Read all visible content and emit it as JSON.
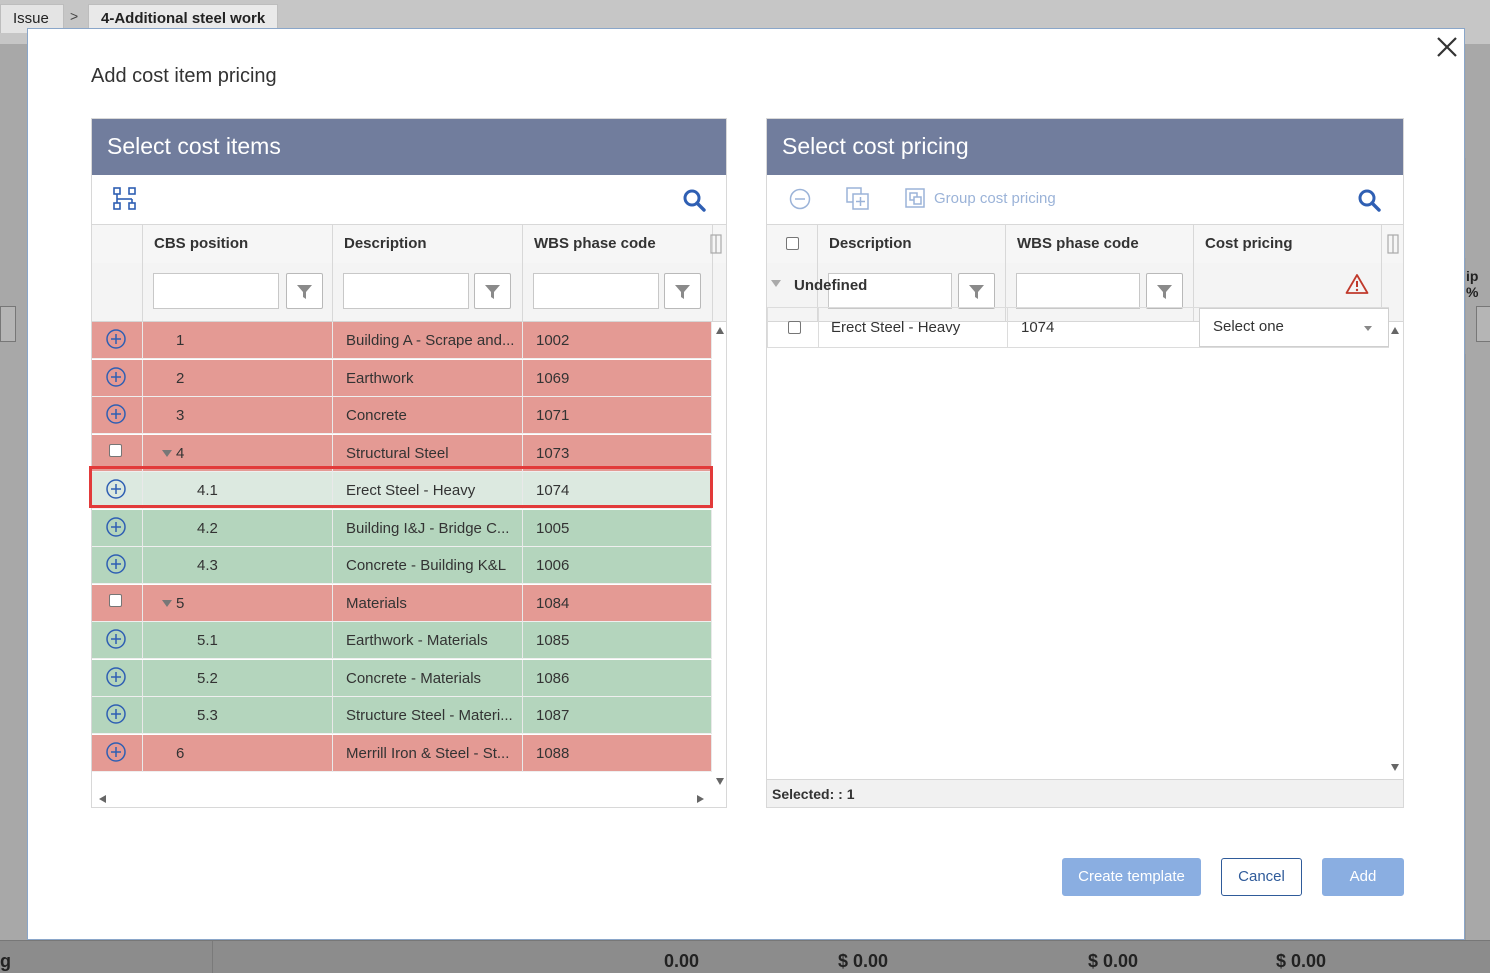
{
  "breadcrumb": {
    "root": "Issue",
    "separator": ">",
    "current": "4-Additional steel work"
  },
  "background": {
    "side_text_left": "g",
    "side_text_right": "ip %",
    "footer_values": [
      "0.00",
      "$ 0.00",
      "$ 0.00",
      "$ 0.00"
    ]
  },
  "dialog": {
    "title": "Add cost item pricing",
    "left_panel": {
      "title": "Select cost items",
      "columns": [
        "CBS position",
        "Description",
        "WBS phase code"
      ],
      "rows": [
        {
          "position": "1",
          "description": "Building A - Scrape and...",
          "wbs": "1002",
          "status": "red",
          "control": "add",
          "level": 0
        },
        {
          "position": "2",
          "description": "Earthwork",
          "wbs": "1069",
          "status": "red",
          "control": "add",
          "level": 0
        },
        {
          "position": "3",
          "description": "Concrete",
          "wbs": "1071",
          "status": "red",
          "control": "add",
          "level": 0
        },
        {
          "position": "4",
          "description": "Structural Steel",
          "wbs": "1073",
          "status": "red",
          "control": "checkbox",
          "level": 0,
          "expanded": true
        },
        {
          "position": "4.1",
          "description": "Erect Steel - Heavy",
          "wbs": "1074",
          "status": "selected",
          "control": "add",
          "level": 1
        },
        {
          "position": "4.2",
          "description": "Building I&J - Bridge C...",
          "wbs": "1005",
          "status": "green",
          "control": "add",
          "level": 1
        },
        {
          "position": "4.3",
          "description": "Concrete - Building K&L",
          "wbs": "1006",
          "status": "green",
          "control": "add",
          "level": 1
        },
        {
          "position": "5",
          "description": "Materials",
          "wbs": "1084",
          "status": "red",
          "control": "checkbox",
          "level": 0,
          "expanded": true
        },
        {
          "position": "5.1",
          "description": "Earthwork - Materials",
          "wbs": "1085",
          "status": "green",
          "control": "add",
          "level": 1
        },
        {
          "position": "5.2",
          "description": "Concrete - Materials",
          "wbs": "1086",
          "status": "green",
          "control": "add",
          "level": 1
        },
        {
          "position": "5.3",
          "description": "Structure Steel - Materi...",
          "wbs": "1087",
          "status": "green",
          "control": "add",
          "level": 1
        },
        {
          "position": "6",
          "description": "Merrill Iron & Steel - St...",
          "wbs": "1088",
          "status": "red",
          "control": "add",
          "level": 0
        }
      ]
    },
    "right_panel": {
      "title": "Select cost pricing",
      "group_button_label": "Group cost pricing",
      "columns": [
        "Description",
        "WBS phase code",
        "Cost pricing"
      ],
      "group_label": "Undefined",
      "rows": [
        {
          "description": "Erect Steel - Heavy",
          "wbs": "1074",
          "cost_pricing": "Select one"
        }
      ],
      "status": "Selected: : 1"
    },
    "buttons": {
      "create_template": "Create template",
      "cancel": "Cancel",
      "add": "Add"
    }
  },
  "colors": {
    "header": "#717d9d",
    "row_red": "#e49a94",
    "row_green": "#b4d5bd",
    "row_selected": "#dce9e0",
    "highlight": "#e23a3a",
    "accent": "#2f5b9a",
    "button_primary": "#8aaee1"
  }
}
